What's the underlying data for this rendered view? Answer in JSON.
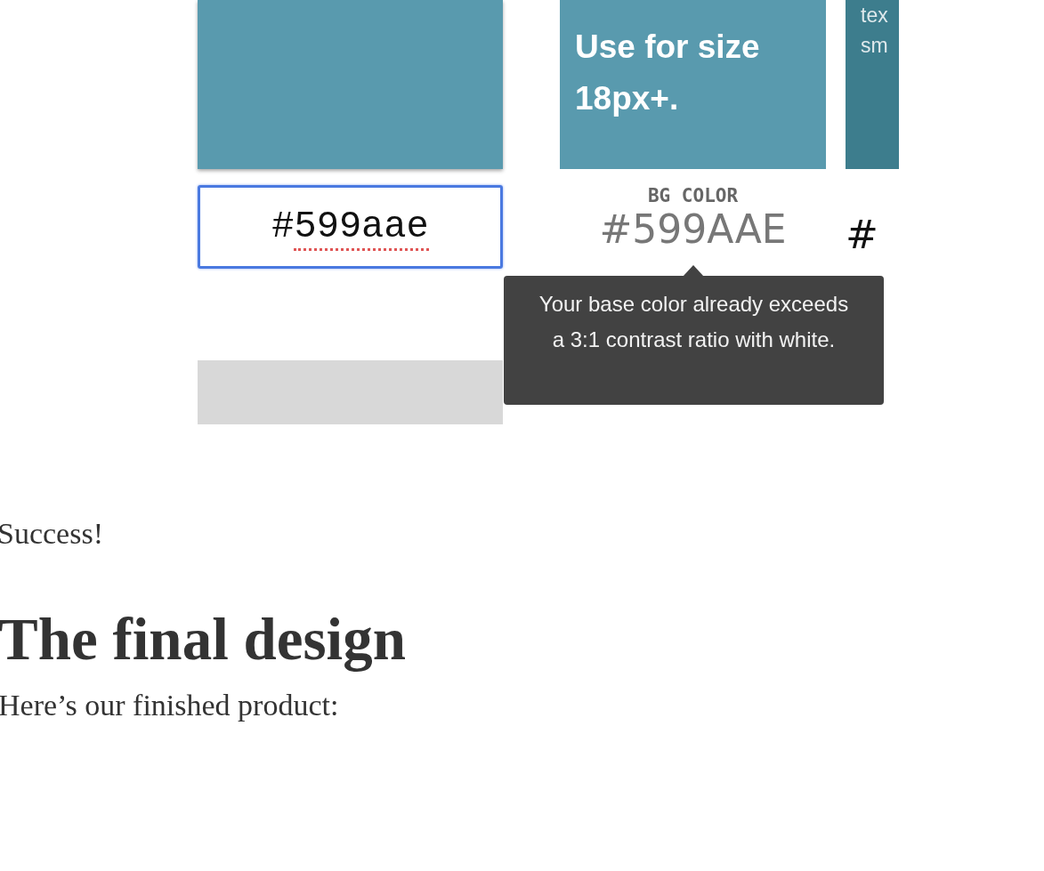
{
  "figure": {
    "swatches": [
      {
        "kind": "input",
        "color": "#599aae",
        "value": "#599aae",
        "misspelled": true
      },
      {
        "kind": "labelled",
        "color": "#599aae",
        "text_lines": [
          "Use for size",
          "18px+."
        ],
        "caption": "BG COLOR",
        "hex": "#599AAE",
        "tooltip": "Your base color already exceeds a 3:1 contrast ratio with white."
      },
      {
        "kind": "labelled",
        "color": "#3d7d8d",
        "text_lines": [
          "tex",
          "sm"
        ],
        "hex": "#"
      }
    ]
  },
  "status": "Success!",
  "heading": "The final design",
  "intro": "Here’s our finished product:"
}
